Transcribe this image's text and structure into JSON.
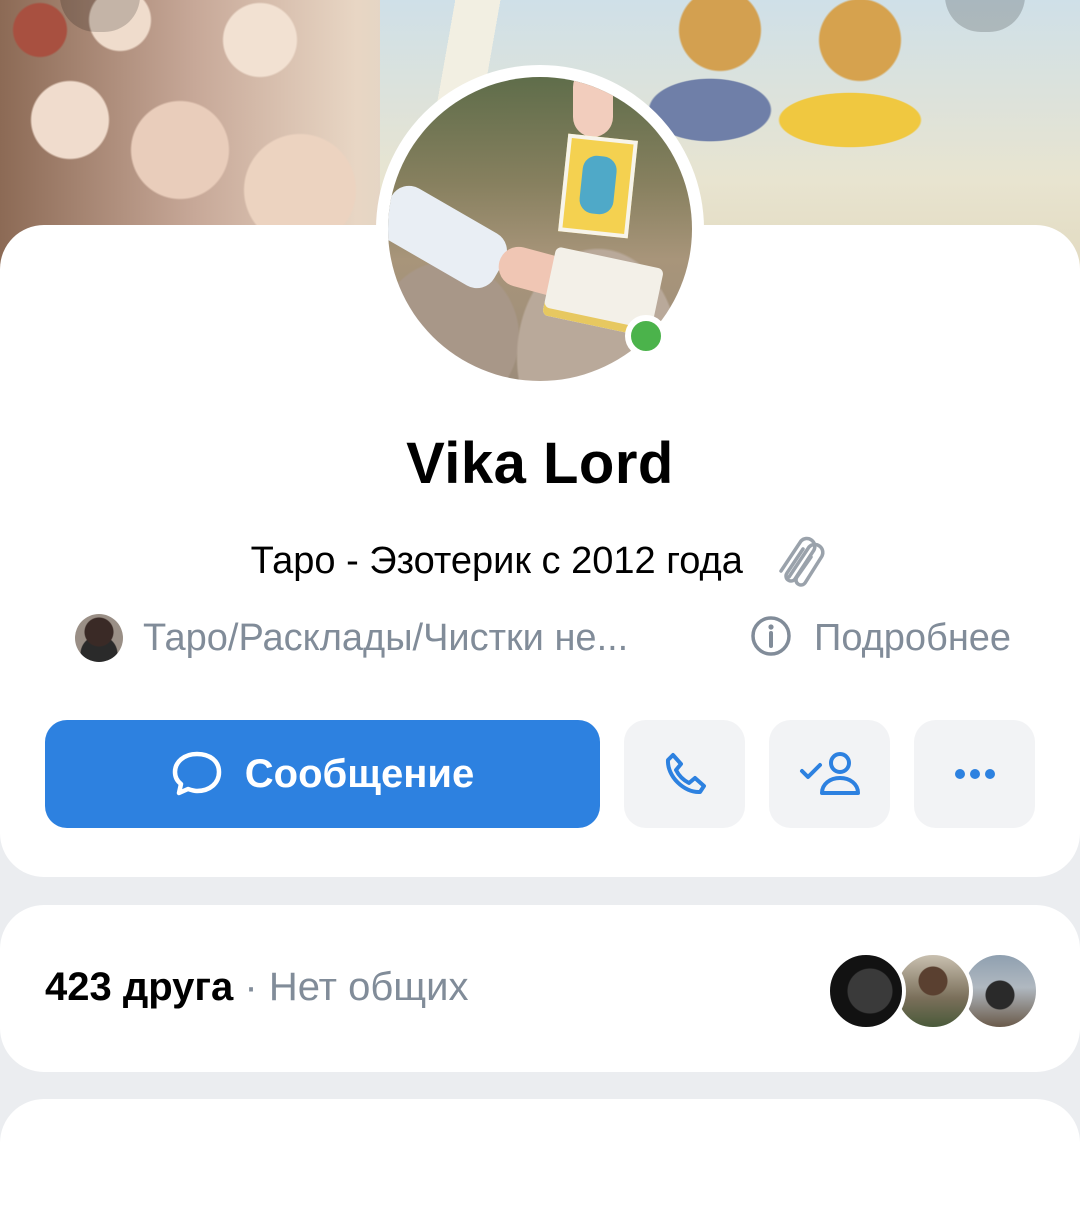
{
  "profile": {
    "name": "Vika Lord",
    "status": "Таро - Эзотерик  с 2012 года",
    "status_emoji": "paperclip-icon",
    "online": true,
    "group_link": "Таро/Расклады/Чистки не...",
    "more_info": "Подробнее"
  },
  "actions": {
    "message_label": "Сообщение",
    "call": "phone-icon",
    "friend": "friend-added-icon",
    "more": "more-horizontal-icon"
  },
  "friends": {
    "count": "423 друга",
    "separator": " · ",
    "mutual": "Нет общих"
  },
  "colors": {
    "accent": "#2d81e0",
    "online": "#4bb34b",
    "secondary_text": "#818c99",
    "page_bg": "#ebedf0"
  }
}
